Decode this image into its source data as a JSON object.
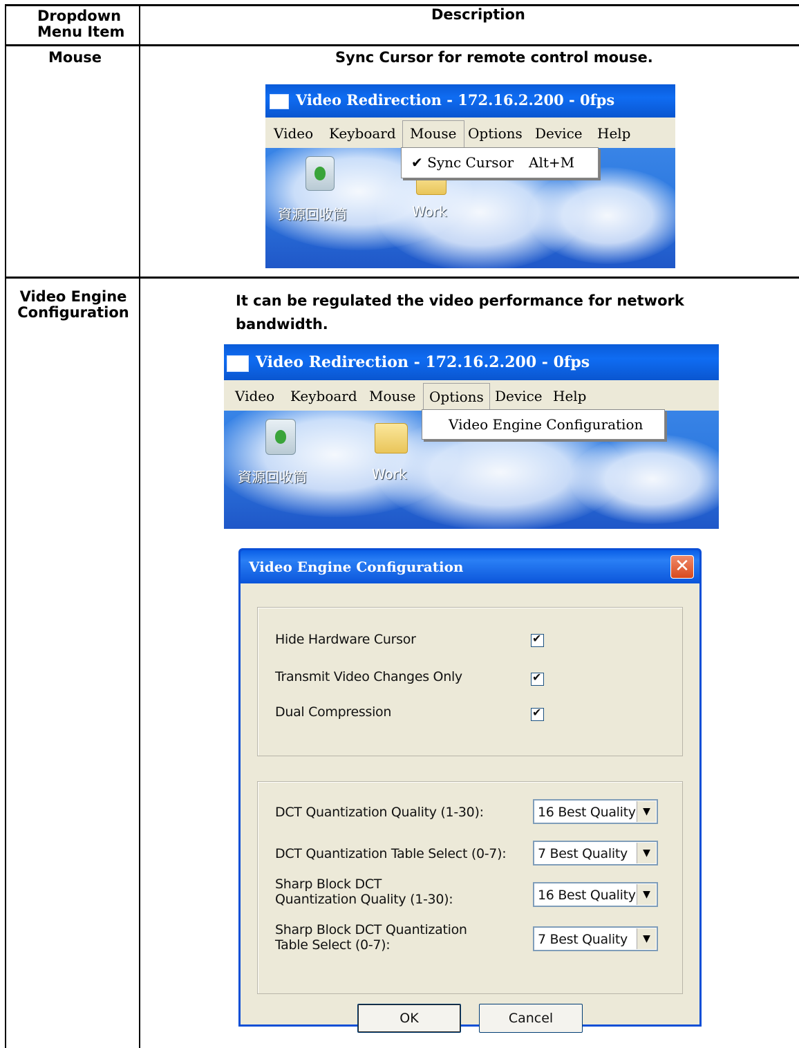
{
  "table": {
    "header": {
      "col1": "Dropdown\nMenu Item",
      "col2": "Description"
    },
    "rows": [
      {
        "item": "Mouse",
        "description": "Sync Cursor for remote control mouse."
      },
      {
        "item": "Video Engine\nConfiguration",
        "description": "It can be regulated the video performance for network\nbandwidth."
      }
    ]
  },
  "screenshot_mouse": {
    "title": "Video Redirection - 172.16.2.200 - 0fps",
    "menu": [
      "Video",
      "Keyboard",
      "Mouse",
      "Options",
      "Device",
      "Help"
    ],
    "active_menu": "Mouse",
    "dropdown_item": "✔ Sync Cursor",
    "dropdown_shortcut": "Alt+M",
    "desktop_icons": [
      "資源回收筒",
      "Work"
    ]
  },
  "screenshot_options": {
    "title": "Video Redirection - 172.16.2.200 - 0fps",
    "menu": [
      "Video",
      "Keyboard",
      "Mouse",
      "Options",
      "Device",
      "Help"
    ],
    "active_menu": "Options",
    "dropdown_item": "Video Engine Configuration",
    "desktop_icons": [
      "資源回收筒",
      "Work"
    ]
  },
  "dialog": {
    "title": "Video Engine Configuration",
    "close_glyph": "✕",
    "checkboxes": [
      {
        "label": "Hide Hardware Cursor",
        "checked": true
      },
      {
        "label": "Transmit Video Changes Only",
        "checked": true
      },
      {
        "label": "Dual Compression",
        "checked": true
      }
    ],
    "combos": [
      {
        "label": "DCT Quantization Quality (1-30):",
        "value": "16 Best Quality"
      },
      {
        "label": "DCT Quantization Table Select (0-7):",
        "value": "7 Best Quality"
      },
      {
        "label": "Sharp Block DCT\nQuantization Quality (1-30):",
        "value": "16 Best Quality"
      },
      {
        "label": "Sharp Block DCT Quantization\nTable Select (0-7):",
        "value": "7 Best Quality"
      }
    ],
    "ok_label": "OK",
    "cancel_label": "Cancel"
  }
}
